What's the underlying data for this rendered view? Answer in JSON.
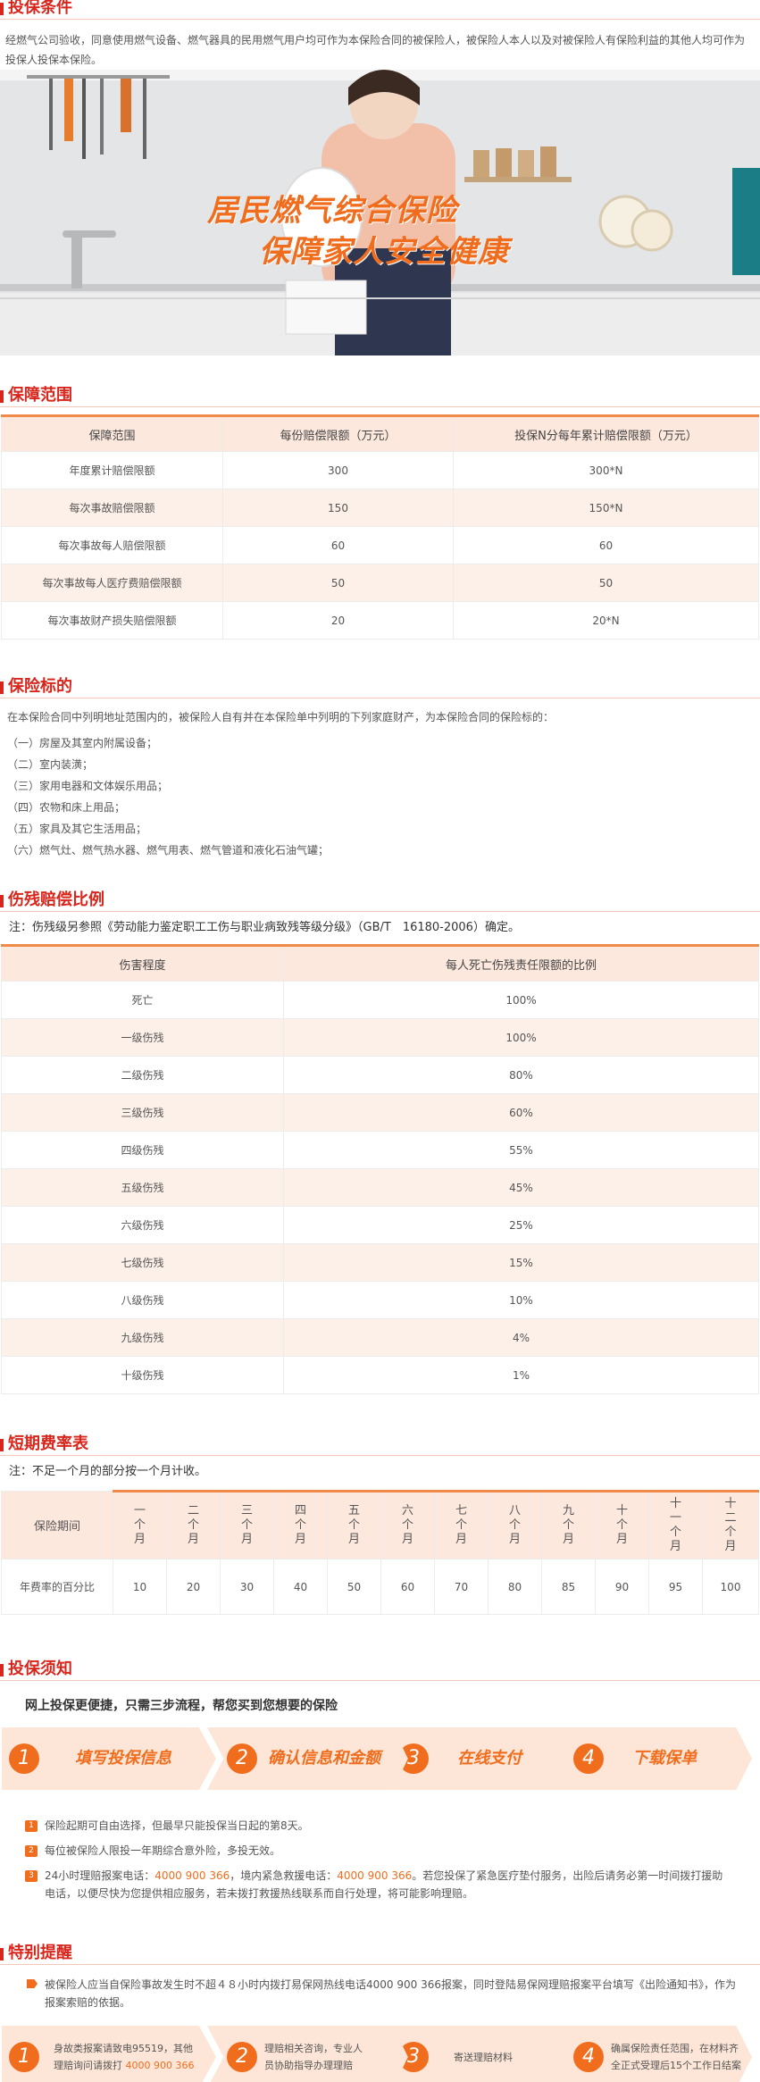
{
  "conditions": {
    "title": "投保条件",
    "text": "经燃气公司验收，同意使用燃气设备、燃气器具的民用燃气用户均可作为本保险合同的被保险人，被保险人本人以及对被保险人有保险利益的其他人均可作为投保人投保本保险。"
  },
  "banner": {
    "line1": "居民燃气综合保险",
    "line2": "保障家人安全健康"
  },
  "coverage": {
    "title": "保障范围",
    "headers": [
      "保障范围",
      "每份赔偿限额（万元）",
      "投保N分每年累计赔偿限额（万元）"
    ],
    "rows": [
      [
        "年度累计赔偿限额",
        "300",
        "300*N"
      ],
      [
        "每次事故赔偿限额",
        "150",
        "150*N"
      ],
      [
        "每次事故每人赔偿限额",
        "60",
        "60"
      ],
      [
        "每次事故每人医疗费赔偿限额",
        "50",
        "50"
      ],
      [
        "每次事故财产损失赔偿限额",
        "20",
        "20*N"
      ]
    ]
  },
  "subject": {
    "title": "保险标的",
    "intro": "在本保险合同中列明地址范围内的，被保险人自有并在本保险单中列明的下列家庭财产，为本保险合同的保险标的：",
    "items": [
      "（一）房屋及其室内附属设备；",
      "（二）室内装潢；",
      "（三）家用电器和文体娱乐用品；",
      "（四）农物和床上用品；",
      "（五）家具及其它生活用品；",
      "（六）燃气灶、燃气热水器、燃气用表、燃气管道和液化石油气罐；"
    ]
  },
  "disability": {
    "title": "伤残赔偿比例",
    "note": "注：伤残级另参照《劳动能力鉴定职工工伤与职业病致残等级分级》（GB/T　16180-2006）确定。",
    "headers": [
      "伤害程度",
      "每人死亡伤残责任限额的比例"
    ],
    "rows": [
      [
        "死亡",
        "100%"
      ],
      [
        "一级伤残",
        "100%"
      ],
      [
        "二级伤残",
        "80%"
      ],
      [
        "三级伤残",
        "60%"
      ],
      [
        "四级伤残",
        "55%"
      ],
      [
        "五级伤残",
        "45%"
      ],
      [
        "六级伤残",
        "25%"
      ],
      [
        "七级伤残",
        "15%"
      ],
      [
        "八级伤残",
        "10%"
      ],
      [
        "九级伤残",
        "4%"
      ],
      [
        "十级伤残",
        "1%"
      ]
    ]
  },
  "shortterm": {
    "title": "短期费率表",
    "note": "注：不足一个月的部分按一个月计收。",
    "row1_label": "保险期间",
    "months": [
      "一个月",
      "二个月",
      "三个月",
      "四个月",
      "五个月",
      "六个月",
      "七个月",
      "八个月",
      "九个月",
      "十个月",
      "十一个月",
      "十二个月"
    ],
    "row2_label": "年费率的百分比",
    "rates": [
      "10",
      "20",
      "30",
      "40",
      "50",
      "60",
      "70",
      "80",
      "85",
      "90",
      "95",
      "100"
    ]
  },
  "notice": {
    "title": "投保须知",
    "subtitle": "网上投保更便捷，只需三步流程，帮您买到您想要的保险",
    "steps": [
      {
        "num": "1",
        "label": "填写投保信息"
      },
      {
        "num": "2",
        "label": "确认信息和金额"
      },
      {
        "num": "3",
        "label": "在线支付"
      },
      {
        "num": "4",
        "label": "下载保单"
      }
    ],
    "items": [
      {
        "num": "1",
        "text": "保险起期可自由选择，但最早只能投保当日起的第8天。"
      },
      {
        "num": "2",
        "text": "每位被保险人限投一年期综合意外险，多投无效。"
      }
    ],
    "item3": {
      "num": "3",
      "a": "24小时理赔报案电话：",
      "phone1": "4000 900 366",
      "b": "，境内紧急救援电话：",
      "phone2": "4000 900 366",
      "c": "。若您投保了紧急医疗垫付服务，出险后请务必第一时间拨打援助电话，以便尽快为您提供相应服务，若未拨打救援热线联系而自行处理，将可能影响理赔。"
    }
  },
  "reminder": {
    "title": "特别提醒",
    "text": "被保险人应当自保险事故发生时不超４８小时内拨打易保网热线电话4000 900 366报案，同时登陆易保网理赔报案平台填写《出险通知书》，作为报案索赔的依据。",
    "steps": [
      {
        "num": "1",
        "line1": "身故类报案请致电95519，其他",
        "line2a": "理赔询问请拨打 ",
        "line2b": "4000 900 366"
      },
      {
        "num": "2",
        "line1": "理赔相关咨询，专业人",
        "line2": "员协助指导办理理赔"
      },
      {
        "num": "3",
        "line1": "寄送理赔材料"
      },
      {
        "num": "4",
        "line1": "确属保险责任范围，在材料齐",
        "line2": "全正式受理后15个工作日结案"
      }
    ]
  }
}
